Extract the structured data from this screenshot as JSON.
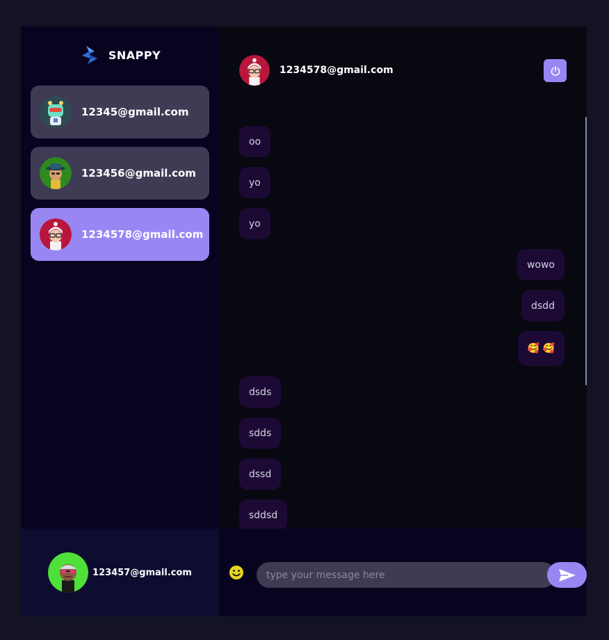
{
  "brand": {
    "name": "SNAPPY",
    "logo_icon": "snappy-logo-icon"
  },
  "contacts": [
    {
      "name": "12345@gmail.com",
      "avatar": "robot-avatar",
      "selected": false
    },
    {
      "name": "123456@gmail.com",
      "avatar": "hat-man-avatar",
      "selected": false
    },
    {
      "name": "1234578@gmail.com",
      "avatar": "nurse-avatar",
      "selected": true
    }
  ],
  "current_user": {
    "name": "123457@gmail.com",
    "avatar": "glasses-man-avatar"
  },
  "chat": {
    "title": "1234578@gmail.com",
    "logout_icon": "power-icon",
    "messages": [
      {
        "text": "oo",
        "side": "received"
      },
      {
        "text": "yo",
        "side": "received"
      },
      {
        "text": "yo",
        "side": "received"
      },
      {
        "text": "wowo",
        "side": "sent"
      },
      {
        "text": "dsdd",
        "side": "sent"
      },
      {
        "text": "🥰 🥰",
        "side": "sent"
      },
      {
        "text": "dsds",
        "side": "received"
      },
      {
        "text": "sdds",
        "side": "received"
      },
      {
        "text": "dssd",
        "side": "received"
      },
      {
        "text": "sddsd",
        "side": "received"
      }
    ]
  },
  "composer": {
    "placeholder": "type your message here",
    "value": "",
    "emoji_icon": "smiley-icon",
    "send_icon": "send-icon"
  },
  "colors": {
    "accent": "#9a86f3",
    "contact_bg": "#3f3b55",
    "bubble_bg": "#1c0a35",
    "sidebar_bg": "#080420",
    "page_bg": "#131324"
  }
}
